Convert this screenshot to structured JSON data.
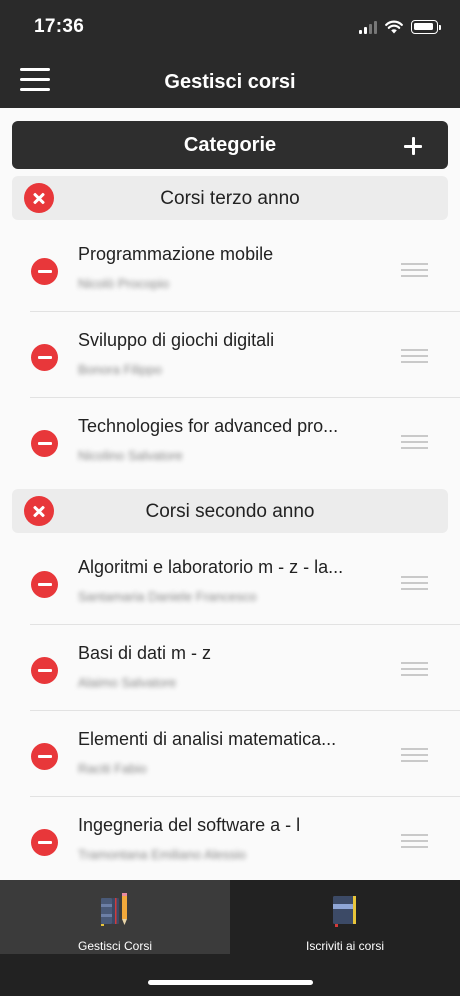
{
  "status_bar": {
    "time": "17:36"
  },
  "nav": {
    "title": "Gestisci corsi"
  },
  "categories": {
    "title": "Categorie"
  },
  "sections": [
    {
      "title": "Corsi terzo anno",
      "courses": [
        {
          "name": "Programmazione mobile",
          "teacher": "Nicolò Procopio"
        },
        {
          "name": "Sviluppo di giochi digitali",
          "teacher": "Bonora Filippo"
        },
        {
          "name": "Technologies for advanced pro...",
          "teacher": "Nicolino Salvatore"
        }
      ]
    },
    {
      "title": "Corsi secondo anno",
      "courses": [
        {
          "name": "Algoritmi e laboratorio m - z - la...",
          "teacher": "Santamaria Daniele Francesco"
        },
        {
          "name": "Basi di dati m - z",
          "teacher": "Alaimo Salvatore"
        },
        {
          "name": "Elementi di analisi matematica...",
          "teacher": "Raciti Fabio"
        },
        {
          "name": "Ingegneria del software a - l",
          "teacher": "Tramontana Emiliano Alessio"
        }
      ]
    }
  ],
  "tabs": [
    {
      "label": "Gestisci Corsi",
      "active": true
    },
    {
      "label": "Iscriviti ai corsi",
      "active": false
    }
  ],
  "colors": {
    "header_bg": "#2a2a2a",
    "delete_red": "#e8373a",
    "section_bg": "#ececec"
  }
}
